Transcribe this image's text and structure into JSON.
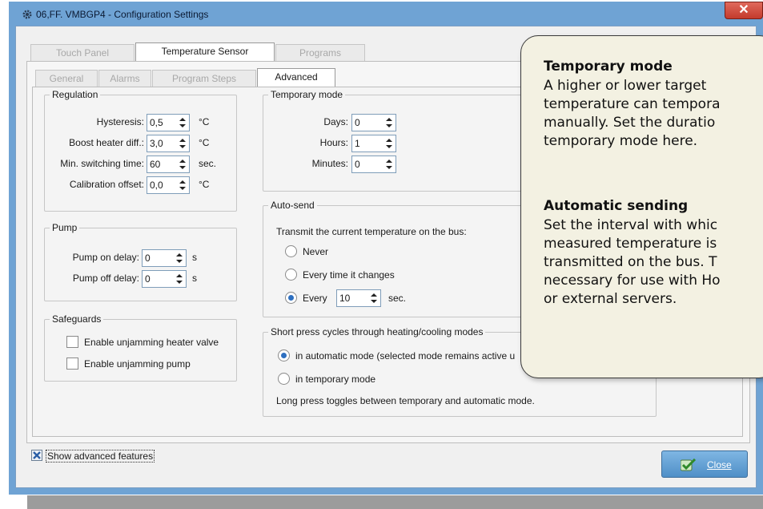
{
  "window": {
    "title": "06,FF. VMBGP4 - Configuration Settings",
    "close_glyph": "✕",
    "accent": "#6fa3d4"
  },
  "main_tabs": [
    {
      "label": "Touch Panel",
      "active": false
    },
    {
      "label": "Temperature Sensor",
      "active": true
    },
    {
      "label": "Programs",
      "active": false
    }
  ],
  "sub_tabs": [
    {
      "label": "General",
      "active": false
    },
    {
      "label": "Alarms",
      "active": false
    },
    {
      "label": "Program Steps",
      "active": false
    },
    {
      "label": "Advanced",
      "active": true
    }
  ],
  "regulation": {
    "legend": "Regulation",
    "rows": [
      {
        "label": "Hysteresis:",
        "value": "0,5",
        "unit": "°C"
      },
      {
        "label": "Boost heater diff.:",
        "value": "3,0",
        "unit": "°C"
      },
      {
        "label": "Min. switching time:",
        "value": "60",
        "unit": "sec."
      },
      {
        "label": "Calibration offset:",
        "value": "0,0",
        "unit": "°C"
      }
    ]
  },
  "pump": {
    "legend": "Pump",
    "rows": [
      {
        "label": "Pump on delay:",
        "value": "0",
        "unit": "s"
      },
      {
        "label": "Pump off delay:",
        "value": "0",
        "unit": "s"
      }
    ]
  },
  "safeguards": {
    "legend": "Safeguards",
    "items": [
      {
        "label": "Enable unjamming heater valve",
        "checked": false
      },
      {
        "label": "Enable unjamming pump",
        "checked": false
      }
    ]
  },
  "temporary_mode": {
    "legend": "Temporary mode",
    "rows": [
      {
        "label": "Days:",
        "value": "0"
      },
      {
        "label": "Hours:",
        "value": "1"
      },
      {
        "label": "Minutes:",
        "value": "0"
      }
    ]
  },
  "auto_send": {
    "legend": "Auto-send",
    "intro": "Transmit the current temperature on the bus:",
    "options": [
      {
        "label": "Never",
        "selected": false
      },
      {
        "label": "Every time it changes",
        "selected": false
      },
      {
        "label": "Every",
        "selected": true
      }
    ],
    "interval_value": "10",
    "interval_unit": "sec."
  },
  "short_press": {
    "legend": "Short press cycles through heating/cooling modes",
    "options": [
      {
        "label": "in automatic mode (selected mode remains active u",
        "selected": true
      },
      {
        "label": "in temporary mode",
        "selected": false
      }
    ],
    "note": "Long press toggles between temporary and automatic mode."
  },
  "tooltip": {
    "heading1": "Temporary mode",
    "body1": [
      "A higher or lower target",
      "temperature can tempora",
      "manually. Set the duratio",
      "temporary mode here."
    ],
    "heading2": "Automatic sending",
    "body2": [
      "Set the interval with whic",
      "measured temperature is",
      "transmitted on the bus. T",
      "necessary for use with Ho",
      "or external servers."
    ]
  },
  "footer": {
    "show_advanced_label": "Show advanced features",
    "show_advanced_checked": true,
    "close_label": "Close"
  }
}
